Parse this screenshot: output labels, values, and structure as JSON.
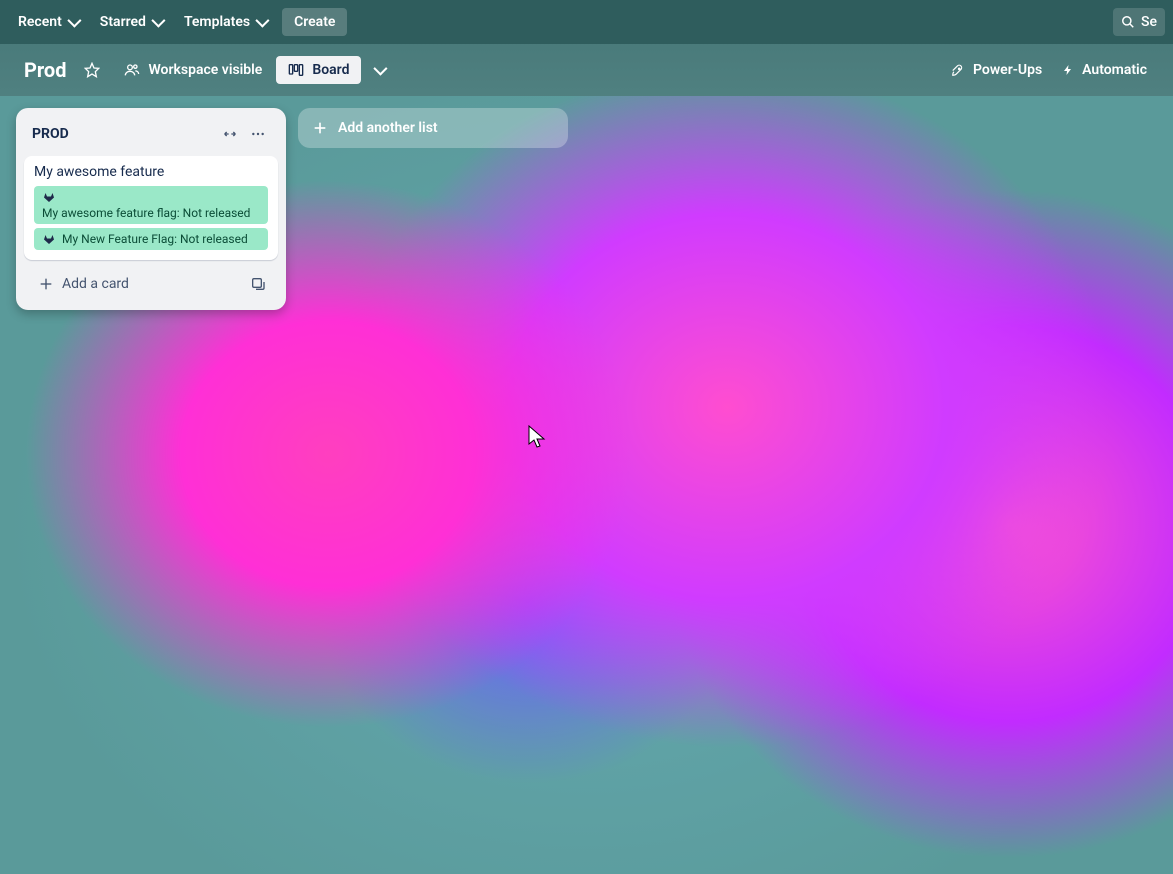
{
  "topnav": {
    "items": [
      "Recent",
      "Starred",
      "Templates"
    ],
    "create": "Create",
    "search_placeholder": "Se"
  },
  "boardbar": {
    "title": "Prod",
    "visibility": "Workspace visible",
    "view": "Board",
    "powerups": "Power-Ups",
    "automation": "Automatic"
  },
  "lists": [
    {
      "title": "PROD",
      "cards": [
        {
          "title": "My awesome feature",
          "badges": [
            {
              "text": "My awesome feature flag: Not released",
              "icon_on_own_line": true
            },
            {
              "text": "My New Feature Flag: Not released",
              "icon_on_own_line": false
            }
          ]
        }
      ],
      "add_card": "Add a card"
    }
  ],
  "add_list": "Add another list"
}
